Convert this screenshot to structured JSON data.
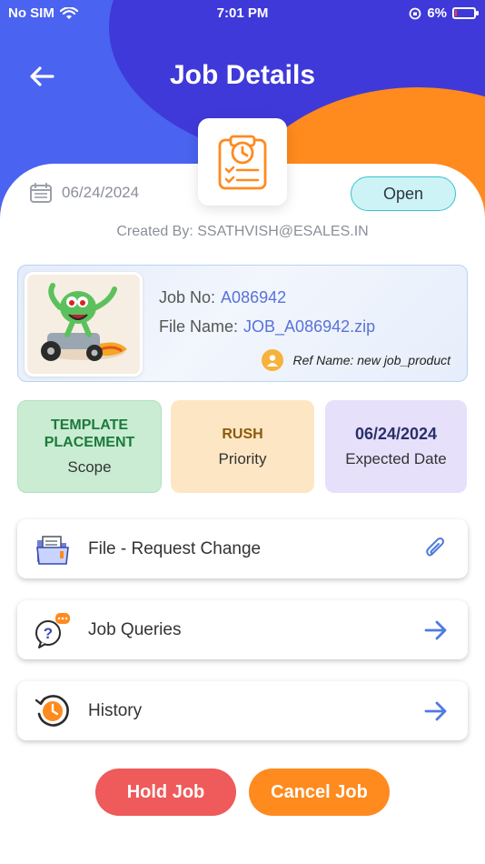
{
  "status_bar": {
    "carrier": "No SIM",
    "time": "7:01 PM",
    "battery": "6%"
  },
  "header": {
    "title": "Job Details"
  },
  "job": {
    "date": "06/24/2024",
    "status": "Open",
    "created_by": "Created By: SSATHVISH@ESALES.IN",
    "job_no_label": "Job No:",
    "job_no": "A086942",
    "file_name_label": "File Name:",
    "file_name": "JOB_A086942.zip",
    "ref_name": "Ref Name: new job_product"
  },
  "tiles": [
    {
      "value": "TEMPLATE PLACEMENT",
      "label": "Scope"
    },
    {
      "value": "RUSH",
      "label": "Priority"
    },
    {
      "value": "06/24/2024",
      "label": "Expected Date"
    }
  ],
  "actions": [
    {
      "label": "File - Request Change",
      "icon": "folder-icon",
      "end_icon": "paperclip-icon"
    },
    {
      "label": "Job Queries",
      "icon": "question-chat-icon",
      "end_icon": "arrow-right-icon"
    },
    {
      "label": "History",
      "icon": "history-icon",
      "end_icon": "arrow-right-icon"
    }
  ],
  "buttons": {
    "hold": "Hold Job",
    "cancel": "Cancel Job"
  },
  "colors": {
    "header_blue": "#4a63f0",
    "accent_orange": "#ff8a1e",
    "hold_red": "#ef5a5a",
    "link_blue": "#5a72d8"
  }
}
